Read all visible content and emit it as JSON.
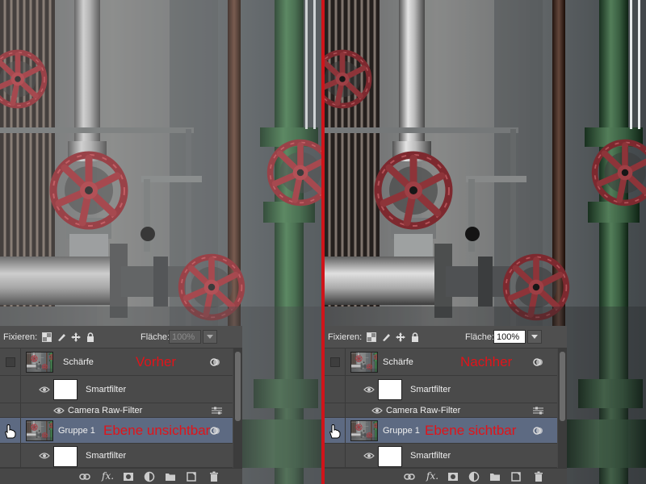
{
  "colors": {
    "divider": "#d0141a",
    "overlay_text": "#e0141a",
    "selected_row": "#5d6a82",
    "panel_bg": "#474747"
  },
  "left": {
    "panel": {
      "lock_label": "Fixieren:",
      "fill_label": "Fläche:",
      "fill_value": "100%",
      "fill_active": false,
      "layers": {
        "sharpen": {
          "name": "Schärfe",
          "overlay": "Vorher"
        },
        "smartfilter_1": {
          "name": "Smartfilter"
        },
        "camera_raw": {
          "name": "Camera Raw-Filter"
        },
        "group": {
          "name": "Gruppe 1",
          "overlay": "Ebene unsichtbar"
        },
        "smartfilter_2": {
          "name": "Smartfilter"
        }
      },
      "bottom": {
        "fx_label": "fx."
      }
    }
  },
  "right": {
    "panel": {
      "lock_label": "Fixieren:",
      "fill_label": "Fläche:",
      "fill_value": "100%",
      "fill_active": true,
      "layers": {
        "sharpen": {
          "name": "Schärfe",
          "overlay": "Nachher"
        },
        "smartfilter_1": {
          "name": "Smartfilter"
        },
        "camera_raw": {
          "name": "Camera Raw-Filter"
        },
        "group": {
          "name": "Gruppe 1",
          "overlay": "Ebene sichtbar"
        },
        "smartfilter_2": {
          "name": "Smartfilter"
        }
      },
      "bottom": {
        "fx_label": "fx."
      }
    }
  }
}
